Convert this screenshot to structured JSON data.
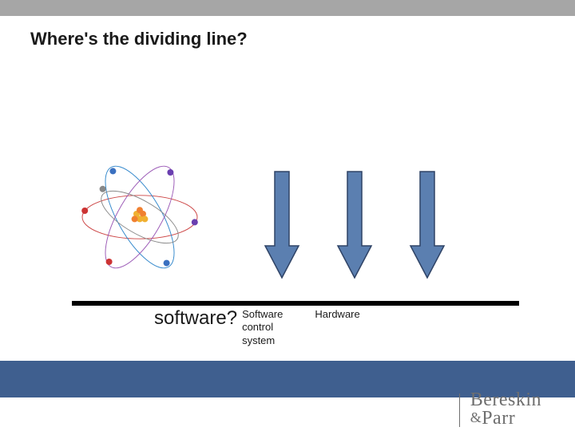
{
  "title": "Where's the dividing line?",
  "labels": {
    "software_big": "software?",
    "software_col_l1": "Software",
    "software_col_l2": "control",
    "software_col_l3": "system",
    "hardware": "Hardware"
  },
  "brand": {
    "line1": "Bereskin",
    "line2_amp": "&",
    "line2_rest": "Parr"
  },
  "colors": {
    "arrow_fill": "#5b7fb0",
    "arrow_stroke": "#2f4366",
    "footer_band": "#3f5f8f",
    "topbar": "#a6a6a6"
  }
}
